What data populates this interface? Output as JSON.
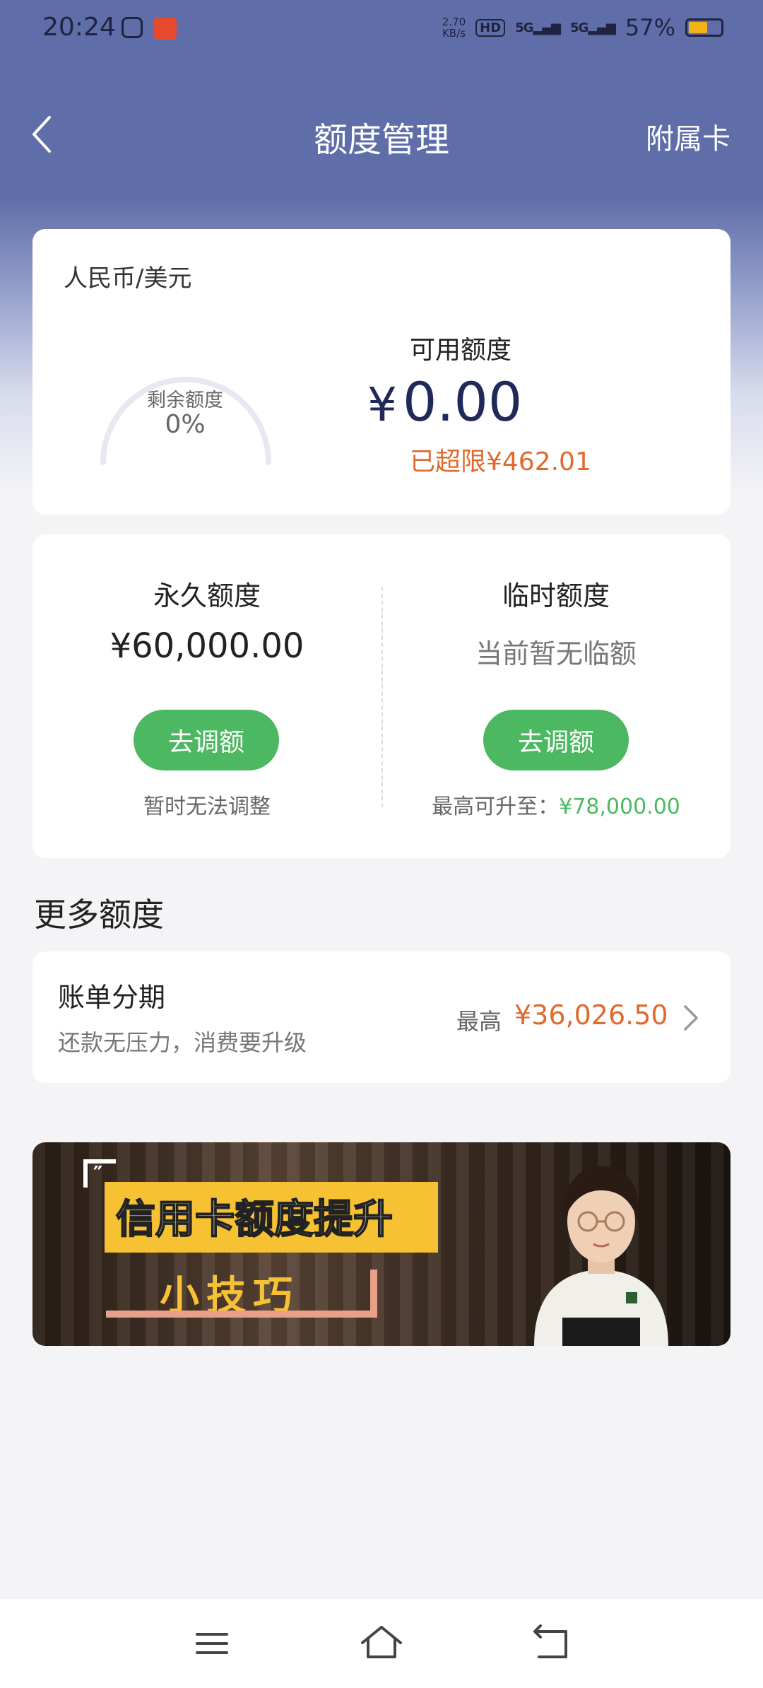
{
  "status_bar": {
    "time": "20:24",
    "speed_value": "2.70",
    "speed_unit": "KB/s",
    "hd": "HD",
    "sim1": "5G",
    "sim2": "5G",
    "battery": "57%",
    "battery_level": 0.57,
    "icons": [
      "tv-icon",
      "bank-app-icon",
      "hd-icon",
      "signal-icon",
      "battery-icon"
    ]
  },
  "header": {
    "title": "额度管理",
    "right_action": "附属卡"
  },
  "overview": {
    "currency": "人民币/美元",
    "gauge_label": "剩余额度",
    "gauge_value": "0%",
    "gauge_fraction": 0,
    "available_label": "可用额度",
    "available_currency": "¥",
    "available_value": "0.00",
    "over_limit": "已超限¥462.01"
  },
  "limits": {
    "permanent": {
      "title": "永久额度",
      "value": "¥60,000.00",
      "button": "去调额",
      "note": "暂时无法调整"
    },
    "temporary": {
      "title": "临时额度",
      "value": "当前暂无临额",
      "button": "去调额",
      "note_prefix": "最高可升至：",
      "note_value": "¥78,000.00"
    }
  },
  "more": {
    "section_title": "更多额度",
    "installment": {
      "title": "账单分期",
      "subtitle": "还款无压力，消费要升级",
      "max_label": "最高",
      "max_value": "¥36,026.50"
    }
  },
  "banner": {
    "title": "信用卡额度提升",
    "subtitle": "小技巧"
  },
  "colors": {
    "header_bg": "#5f6ea9",
    "accent_green": "#4cb862",
    "accent_orange": "#e06a2e",
    "amount_navy": "#1f2a5a"
  }
}
